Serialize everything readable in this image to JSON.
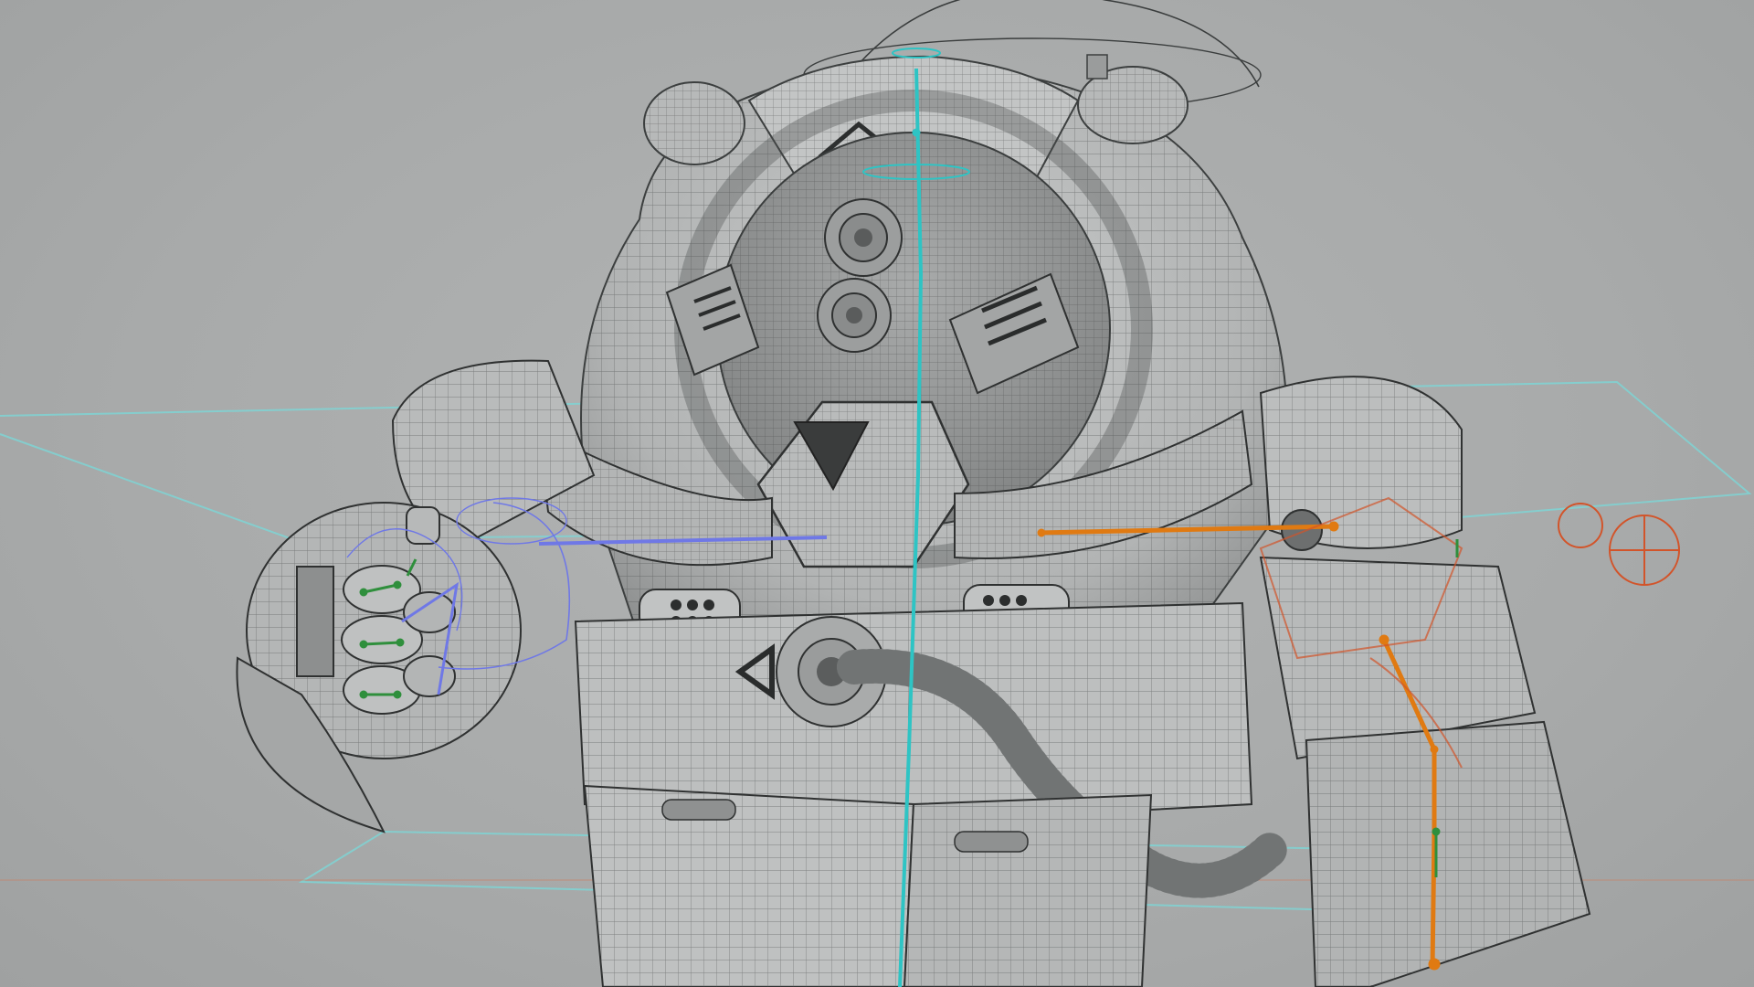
{
  "viewport": {
    "background": "#a9abab",
    "mesh_shade": "#b9bbbb",
    "mesh_shade_dark": "#8e9090",
    "wire_color": "#3f4242",
    "control_colors": {
      "spine": "#2ec4c4",
      "left_arm_control": "#6f78e6",
      "right_arm_joint": "#e07a12",
      "ik_handle": "#d2542a",
      "bone_marker": "#2f8f3c",
      "ground_curve": "#7fd3d3"
    }
  },
  "model": {
    "subject": "armored-robot-character",
    "display_mode": "shaded-with-wireframe",
    "rig_visible": true
  },
  "markers": [
    {
      "kind": "triangle-arrow-up"
    },
    {
      "kind": "triangle-arrow-down"
    },
    {
      "kind": "triangle-arrow-left"
    }
  ]
}
